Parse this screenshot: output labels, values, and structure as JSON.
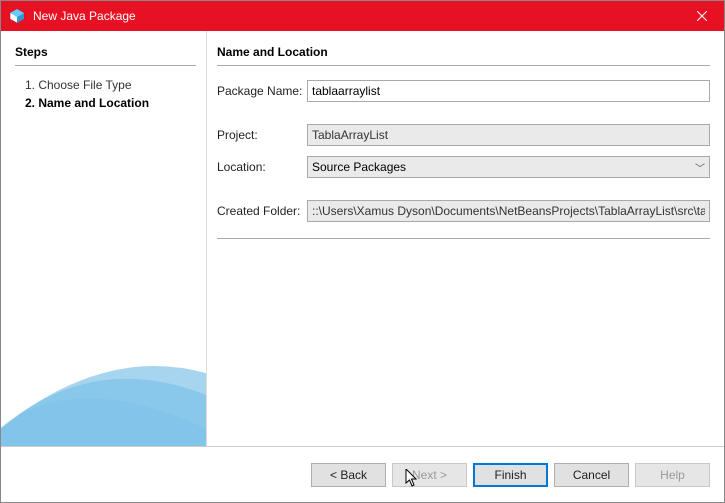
{
  "window": {
    "title": "New Java Package"
  },
  "steps": {
    "heading": "Steps",
    "items": [
      {
        "label": "Choose File Type",
        "current": false
      },
      {
        "label": "Name and Location",
        "current": true
      }
    ]
  },
  "form": {
    "heading": "Name and Location",
    "packageName": {
      "label": "Package Name:",
      "value": "tablaarraylist"
    },
    "project": {
      "label": "Project:",
      "value": "TablaArrayList"
    },
    "location": {
      "label": "Location:",
      "value": "Source Packages"
    },
    "createdFolder": {
      "label": "Created Folder:",
      "value": "::\\Users\\Xamus Dyson\\Documents\\NetBeansProjects\\TablaArrayList\\src\\tablaarraylist"
    }
  },
  "buttons": {
    "back": "< Back",
    "next": "Next >",
    "finish": "Finish",
    "cancel": "Cancel",
    "help": "Help"
  }
}
